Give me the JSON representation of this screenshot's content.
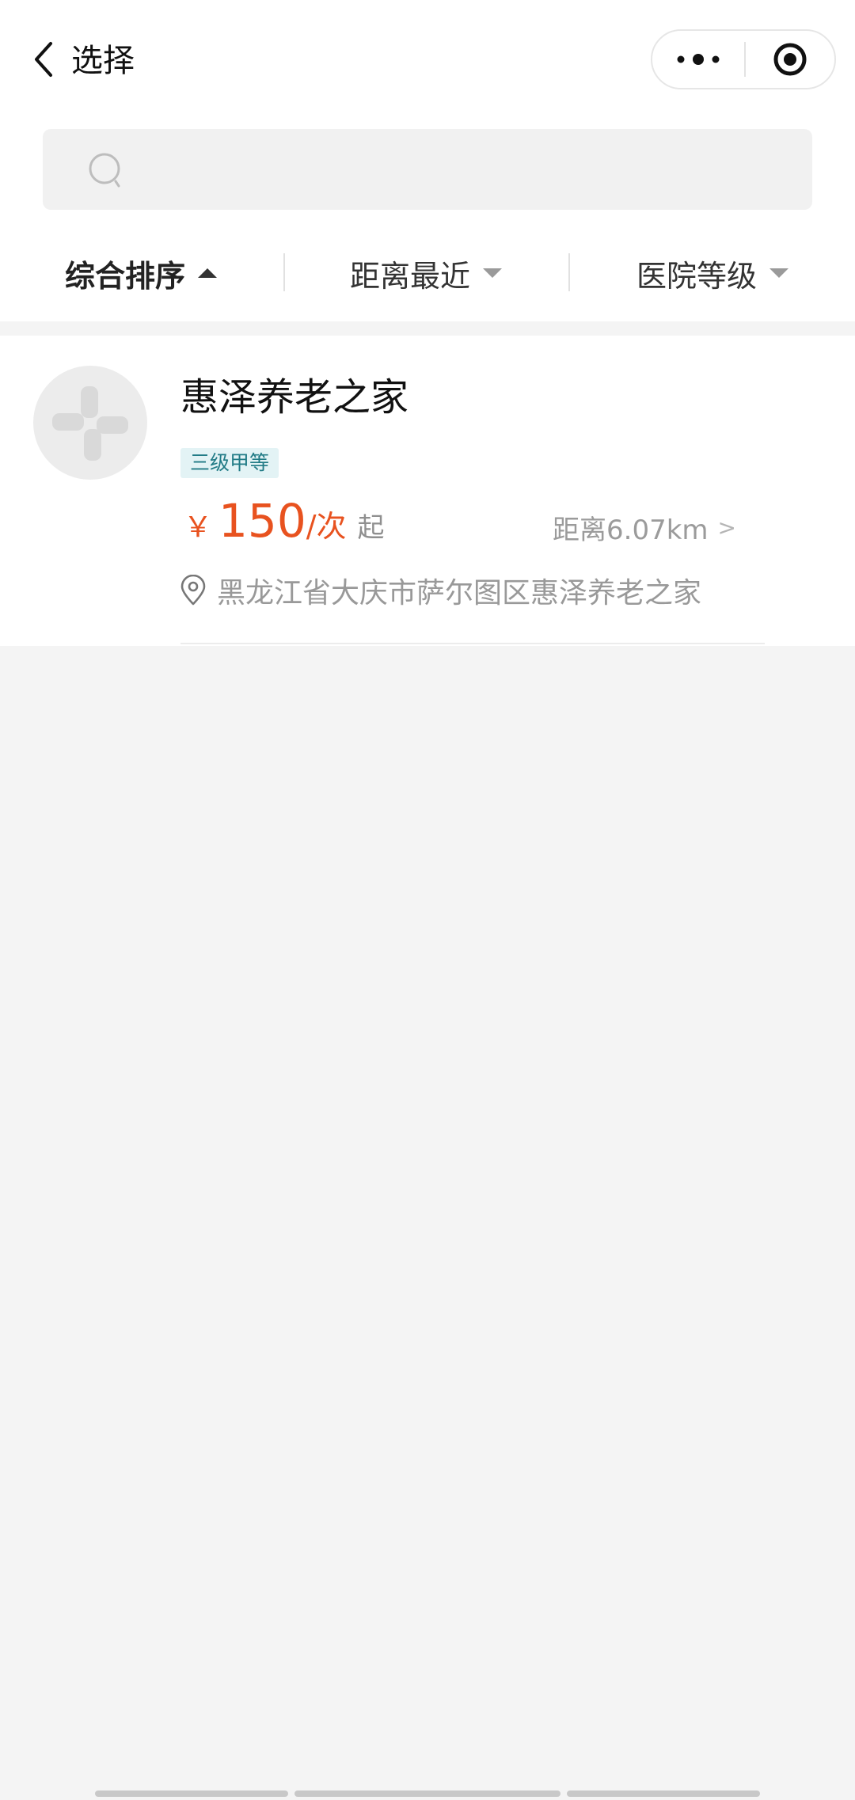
{
  "nav": {
    "title": "选择"
  },
  "search": {
    "placeholder": "",
    "value": ""
  },
  "filters": [
    {
      "label": "综合排序",
      "active": true,
      "arrow": "up"
    },
    {
      "label": "距离最近",
      "active": false,
      "arrow": "down"
    },
    {
      "label": "医院等级",
      "active": false,
      "arrow": "down"
    }
  ],
  "results": [
    {
      "name": "惠泽养老之家",
      "grade": "三级甲等",
      "price_currency": "￥",
      "price_value": "150",
      "price_unit": "/次",
      "price_suffix": "起",
      "distance": "距离6.07km",
      "distance_chevron": ">",
      "address": "黑龙江省大庆市萨尔图区惠泽养老之家"
    }
  ],
  "colors": {
    "accent_price": "#e8521f",
    "grade_tag_bg": "#e3f3f5",
    "grade_tag_text": "#217b86",
    "page_bg": "#f4f4f4"
  },
  "icons": {
    "back": "chevron-left-icon",
    "more": "more-dots-icon",
    "close": "target-circle-icon",
    "search": "search-icon",
    "location": "location-pin-icon",
    "avatar": "hospital-cross-icon"
  }
}
